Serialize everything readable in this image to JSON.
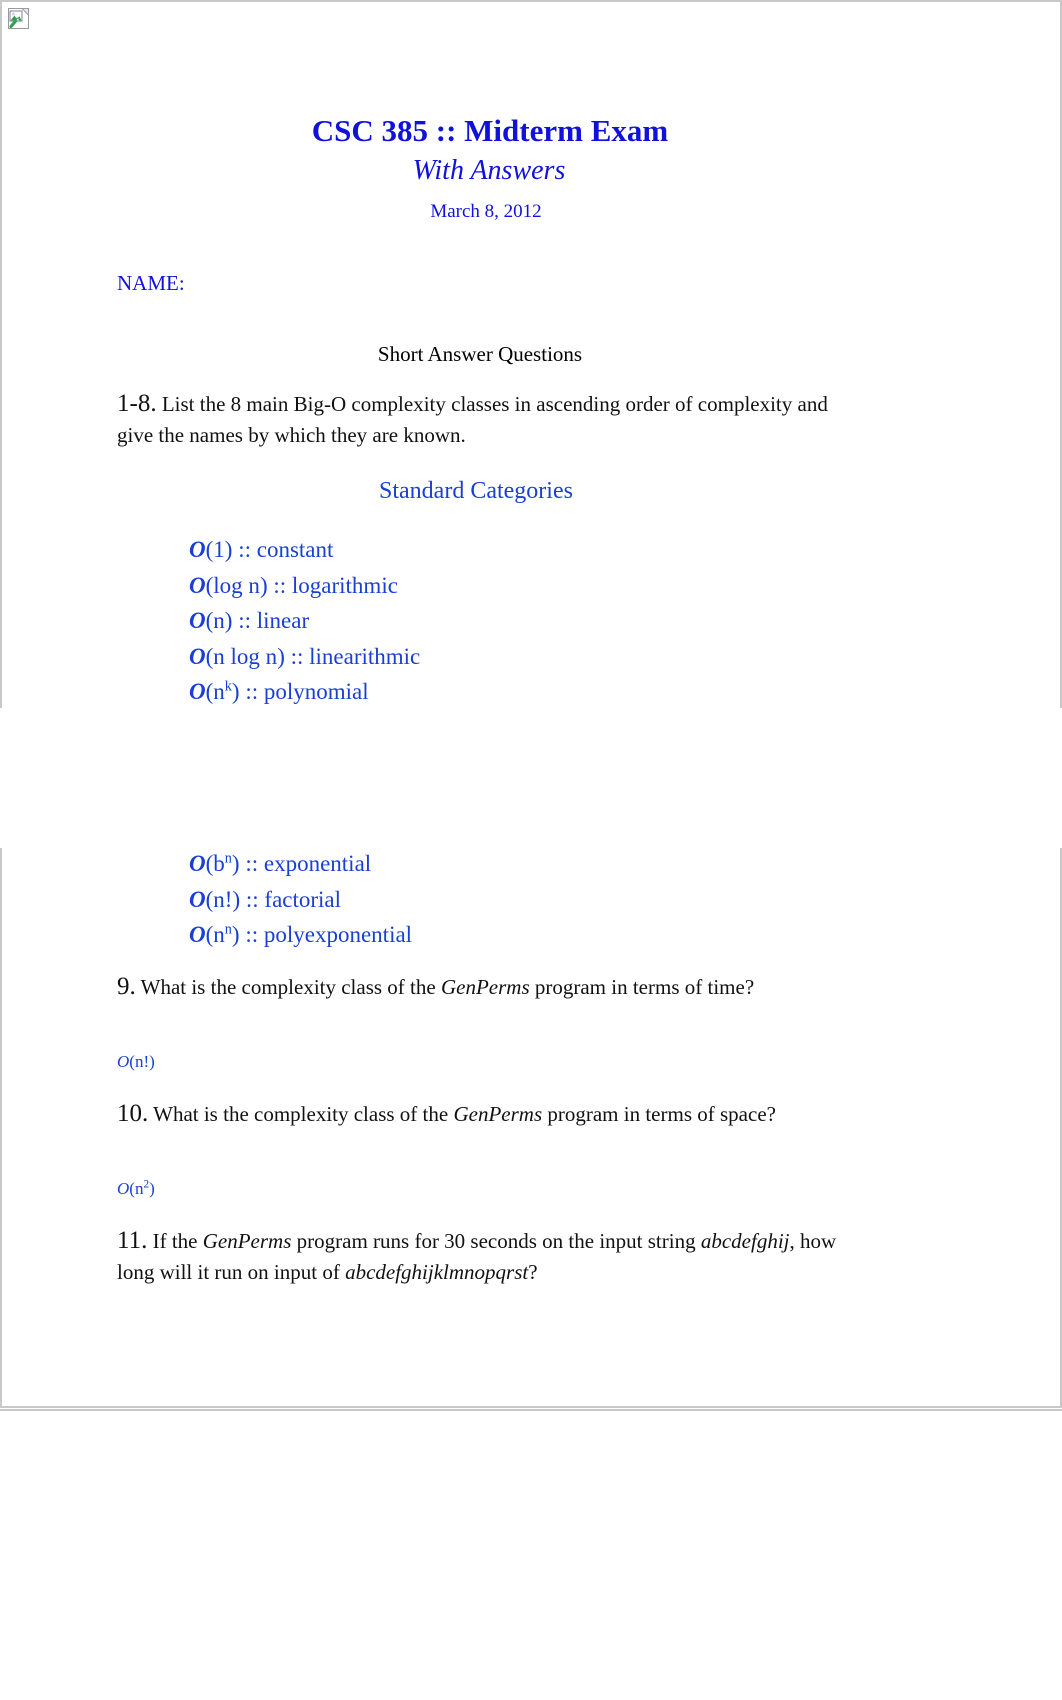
{
  "document": {
    "title": "CSC 385 :: Midterm Exam",
    "subtitle": "With Answers",
    "date": "March 8, 2012",
    "name_label": "NAME:",
    "section_heading": "Short Answer Questions"
  },
  "questions": {
    "q1_8": {
      "number": "1-8.",
      "text": " List the 8 main Big-O complexity classes in ascending order of complexity and give the names by which they are known.",
      "answer_heading": "Standard Categories"
    },
    "q9": {
      "number": "9.",
      "text_before": " What is the complexity class of the ",
      "emphasis": "GenPerms",
      "text_after": " program in terms of time?",
      "answer_o": "O",
      "answer_rest": "(n!)"
    },
    "q10": {
      "number": "10.",
      "text_before": " What is the complexity class of the ",
      "emphasis": "GenPerms",
      "text_after": " program in terms of space?",
      "answer_o": "O",
      "answer_open": "(n",
      "answer_sup": "2",
      "answer_close": ")"
    },
    "q11": {
      "number": "11.",
      "text_a": " If the ",
      "emphasis_1": "GenPerms",
      "text_b": " program runs for 30 seconds on the input string ",
      "emphasis_2": "abcdefghij",
      "text_c": ", how long will it run on input of ",
      "emphasis_3": "abcdefghijklmnopqrst",
      "text_d": "?"
    }
  },
  "complexity_classes_group_one": [
    {
      "o": "O",
      "open": "(1",
      "sup": "",
      "close": ")",
      "sep": " :: ",
      "name": "constant"
    },
    {
      "o": "O",
      "open": "(log n",
      "sup": "",
      "close": ")",
      "sep": " :: ",
      "name": "logarithmic"
    },
    {
      "o": "O",
      "open": "(n",
      "sup": "",
      "close": ")",
      "sep": " :: ",
      "name": "linear"
    },
    {
      "o": "O",
      "open": "(n log n",
      "sup": "",
      "close": ")",
      "sep": " :: ",
      "name": "linearithmic"
    },
    {
      "o": "O",
      "open": "(n",
      "sup": "k",
      "close": ")",
      "sep": " :: ",
      "name": "polynomial"
    }
  ],
  "complexity_classes_group_two": [
    {
      "o": "O",
      "open": "(b",
      "sup": "n",
      "close": ")",
      "sep": " :: ",
      "name": "exponential"
    },
    {
      "o": "O",
      "open": "(n!",
      "sup": "",
      "close": ")",
      "sep": " :: ",
      "name": "factorial"
    },
    {
      "o": "O",
      "open": "(n",
      "sup": "n",
      "close": ")",
      "sep": " :: ",
      "name": "polyexponential"
    }
  ],
  "colors": {
    "heading_blue": "#1111dd",
    "answer_blue": "#1a3fd4",
    "body_black": "#111111",
    "page_border": "#c8c8c8"
  },
  "icons": {
    "broken_image": "broken-image-icon"
  }
}
